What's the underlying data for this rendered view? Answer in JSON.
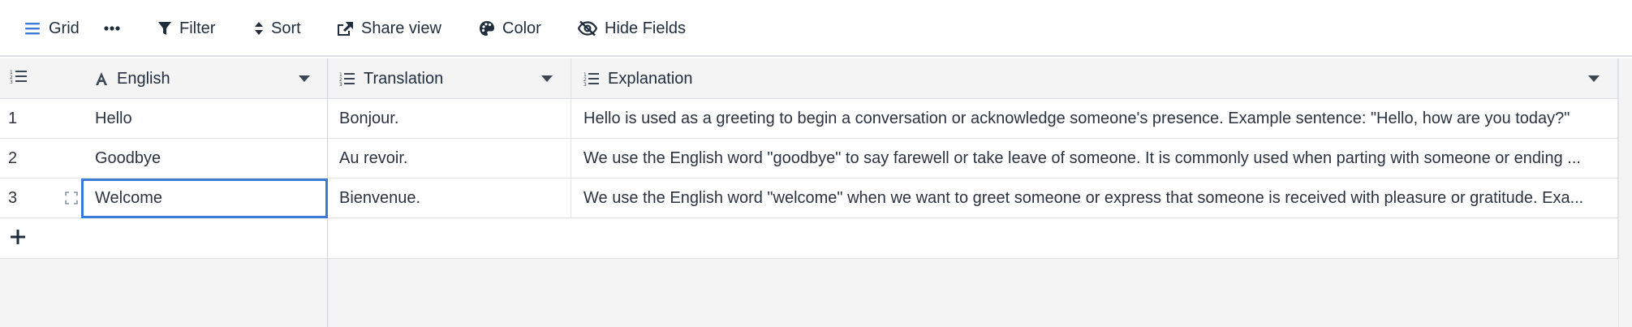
{
  "toolbar": {
    "grid_label": "Grid",
    "filter_label": "Filter",
    "sort_label": "Sort",
    "share_label": "Share view",
    "color_label": "Color",
    "hide_label": "Hide Fields"
  },
  "columns": {
    "english": "English",
    "translation": "Translation",
    "explanation": "Explanation"
  },
  "rows": [
    {
      "num": "1",
      "english": "Hello",
      "translation": "Bonjour.",
      "explanation": "Hello is used as a greeting to begin a conversation or acknowledge someone's presence. Example sentence: \"Hello, how are you today?\""
    },
    {
      "num": "2",
      "english": "Goodbye",
      "translation": "Au revoir.",
      "explanation": "We use the English word \"goodbye\" to say farewell or take leave of someone. It is commonly used when parting with someone or ending ..."
    },
    {
      "num": "3",
      "english": "Welcome",
      "translation": "Bienvenue.",
      "explanation": "We use the English word \"welcome\" when we want to greet someone or express that someone is received with pleasure or gratitude. Exa..."
    }
  ],
  "colors": {
    "accent": "#3a7bd5",
    "text": "#1f2d3d",
    "grid_bg": "#f4f4f5"
  },
  "icons": {
    "grid": "hamburger-icon",
    "more": "ellipsis-icon",
    "filter": "funnel-icon",
    "sort": "sort-arrows-icon",
    "share": "share-icon",
    "color": "palette-icon",
    "hide": "eye-slash-icon",
    "text_field": "letter-a-icon",
    "long_text": "list-icon",
    "add": "plus-icon",
    "expand": "expand-icon"
  }
}
